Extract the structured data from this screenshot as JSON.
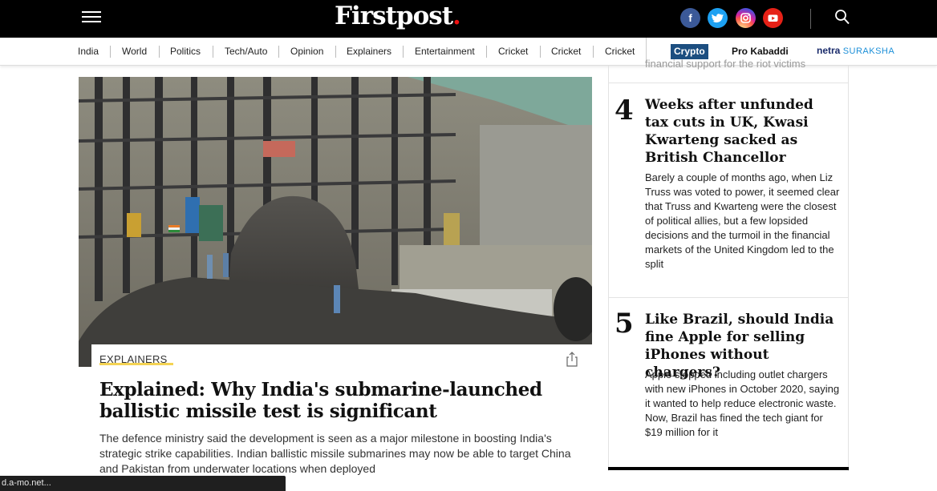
{
  "header": {
    "logo_text": "Firstpost",
    "logo_dot": ".",
    "social": [
      {
        "name": "facebook",
        "glyph": "f",
        "color": "#3b5998"
      },
      {
        "name": "twitter",
        "glyph": "t",
        "color": "#1da1f2"
      },
      {
        "name": "instagram",
        "glyph": "◎",
        "color": "#d6249f"
      },
      {
        "name": "youtube",
        "glyph": "▶",
        "color": "#e62117"
      }
    ]
  },
  "nav": {
    "items": [
      "India",
      "World",
      "Politics",
      "Tech/Auto",
      "Opinion",
      "Explainers",
      "Entertainment",
      "Cricket",
      "Cricket",
      "Cricket"
    ],
    "crypto": "Crypto",
    "pro_kabaddi": "Pro Kabaddi",
    "netra_a": "netra",
    "netra_b": "SURAKSHA"
  },
  "main_article": {
    "category": "EXPLAINERS",
    "headline": "Explained: Why India's submarine-launched ballistic missile test is significant",
    "summary": "The defence ministry said the development is seen as a major milestone in boosting India's strategic strike capabilities. Indian ballistic missile submarines may now be able to target China and Pakistan from underwater locations when deployed",
    "image_alt": "submarine-image"
  },
  "trending": {
    "top_partial": "financial support for the riot victims",
    "items": [
      {
        "rank": "4",
        "title": "Weeks after unfunded tax cuts in UK, Kwasi Kwarteng sacked as British Chancellor",
        "desc": "Barely a couple of months ago, when Liz Truss was voted to power, it seemed clear that Truss and Kwarteng were the closest of political allies, but a few lopsided decisions and the turmoil in the financial markets of the United Kingdom led to the split"
      },
      {
        "rank": "5",
        "title": "Like Brazil, should India fine Apple for selling iPhones without chargers?",
        "desc": "Apple stopped including outlet chargers with new iPhones in October 2020, saying it wanted to help reduce electronic waste. Now, Brazil has fined the tech giant for $19 million for it"
      }
    ]
  },
  "status_bar": {
    "text": "d.a-mo.net..."
  }
}
